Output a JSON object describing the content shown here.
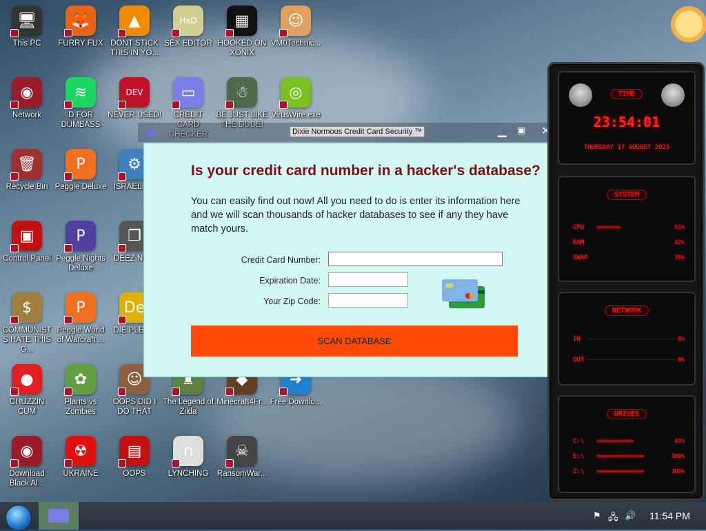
{
  "desktop": {
    "icons": [
      {
        "label": "This PC",
        "glyph": "🖥",
        "color": "#333"
      },
      {
        "label": "FURRY FUX",
        "glyph": "🦊",
        "color": "#e8641a"
      },
      {
        "label": "DONT STICK THIS IN YO...",
        "glyph": "▲",
        "color": "#f08a00"
      },
      {
        "label": "SEX EDITOR",
        "glyph": "HxD",
        "color": "#cfcf90"
      },
      {
        "label": "HOOKED ON XONIX",
        "glyph": "▦",
        "color": "#111"
      },
      {
        "label": "VM0Technic...",
        "glyph": "☺",
        "color": "#e0a060"
      },
      {
        "label": "Network",
        "glyph": "◉",
        "color": "#9a1c2a"
      },
      {
        "label": "D FOR DUMBASS",
        "glyph": "≋",
        "color": "#1ed760"
      },
      {
        "label": "NEVER USED!",
        "glyph": "DEV",
        "color": "#c0102a"
      },
      {
        "label": "CREDIT CARD CHECKER",
        "glyph": "▭",
        "color": "#7a7fe8"
      },
      {
        "label": "BE JUST LIKE THE DUDE!",
        "glyph": "☃",
        "color": "#4a6a4a"
      },
      {
        "label": "VirusWire.exe",
        "glyph": "◎",
        "color": "#7ac020"
      },
      {
        "label": "Recycle Bin",
        "glyph": "🗑",
        "color": "#a03030"
      },
      {
        "label": "Peggle Deluxe",
        "glyph": "P",
        "color": "#f07020"
      },
      {
        "label": "ISRAEL S...",
        "glyph": "⚙",
        "color": "#4080c0"
      },
      {
        "label": "Control Panel",
        "glyph": "▣",
        "color": "#c01010"
      },
      {
        "label": "Peggle Nights Deluxe",
        "glyph": "P",
        "color": "#5040a0"
      },
      {
        "label": "DEEZ NU...",
        "glyph": "❐",
        "color": "#555"
      },
      {
        "label": "COMMUNISTS HATE THIS G...",
        "glyph": "$",
        "color": "#a08040"
      },
      {
        "label": "Peggle World of Warcraft ...",
        "glyph": "P",
        "color": "#f07020"
      },
      {
        "label": "DIE PLEA...",
        "glyph": "De",
        "color": "#e0b000"
      },
      {
        "label": "CHUZZIN CUM",
        "glyph": "●",
        "color": "#e02020"
      },
      {
        "label": "Plants vs Zombies",
        "glyph": "✿",
        "color": "#60a040"
      },
      {
        "label": "OOPS DID I DO THAT",
        "glyph": "☺",
        "color": "#8a6040"
      },
      {
        "label": "The Legend of Zilda",
        "glyph": "♜",
        "color": "#608040"
      },
      {
        "label": "Minecraft4Fr...",
        "glyph": "◆",
        "color": "#604020"
      },
      {
        "label": "Free Downlo...",
        "glyph": "➜",
        "color": "#2080d0"
      },
      {
        "label": "Download Black Al...",
        "glyph": "◉",
        "color": "#9a1c2a"
      },
      {
        "label": "UKRAINE",
        "glyph": "☢",
        "color": "#e01010"
      },
      {
        "label": "OOPS",
        "glyph": "▤",
        "color": "#c01010"
      },
      {
        "label": "LYNCHING",
        "glyph": "∩",
        "color": "#ddd"
      },
      {
        "label": "RansomWar...",
        "glyph": "☠",
        "color": "#444"
      }
    ]
  },
  "window": {
    "title": "Dixie Normous Credit Card Security ™",
    "minimize": "▁",
    "maximize": "▣",
    "close": "✕",
    "headline": "Is your credit card number in a hacker's database?",
    "intro": "You can easily find out now! All you need to do is enter its information here and we will scan thousands of hacker databases to see if any they have match yours.",
    "fields": {
      "card_label": "Credit Card Number:",
      "card_value": "",
      "exp_label": "Expiration Date:",
      "exp_value": "",
      "zip_label": "Your Zip Code:",
      "zip_value": ""
    },
    "scan_button": "SCAN DATABASE",
    "accent_color": "#ff4a07"
  },
  "gadget": {
    "time_title": "TIME",
    "time": "23:54:01",
    "date": "THURSDAY 17 AUGUST 2023",
    "system_title": "SYSTEM",
    "system_rows": [
      {
        "label": "CPU",
        "bar": ">>>>>>>>>",
        "pct": "51%"
      },
      {
        "label": "RAM",
        "bar": "",
        "pct": "42%"
      },
      {
        "label": "SWAP",
        "bar": "",
        "pct": "35%"
      }
    ],
    "network_title": "NETWORK",
    "network_rows": [
      {
        "label": "IN",
        "pct": "0%"
      },
      {
        "label": "OUT",
        "pct": "0%"
      }
    ],
    "drives_title": "DRIVES",
    "drives_rows": [
      {
        "label": "C:\\",
        "bar": ">>>>>>>>>>>>>>",
        "pct": "43%"
      },
      {
        "label": "E:\\",
        "bar": ">>>>>>>>>>>>>>>>>>",
        "pct": "100%"
      },
      {
        "label": "Z:\\",
        "bar": ">>>>>>>>>>>>>>>>>>",
        "pct": "100%"
      }
    ]
  },
  "taskbar": {
    "clock": "11:54 PM",
    "tray_icons": [
      "flag-icon",
      "network-icon",
      "volume-icon"
    ]
  }
}
